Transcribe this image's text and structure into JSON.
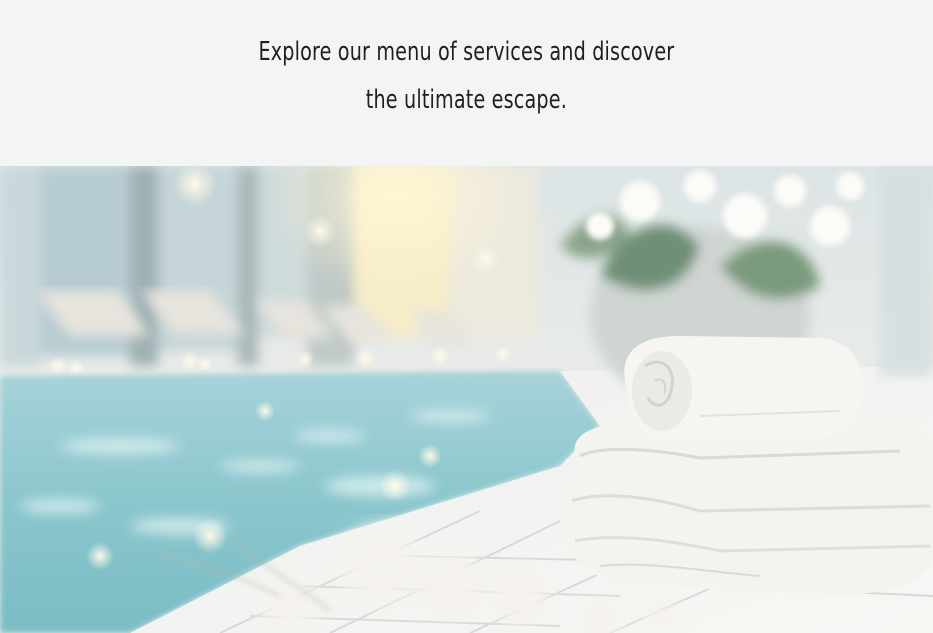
{
  "intro": {
    "line1": "Explore our menu of services and discover",
    "line2": "the ultimate escape."
  },
  "hero": {
    "subject": "spa-pool-towels-photo",
    "colors": {
      "pool": "#8ac6cd",
      "towel": "#f4f3ef",
      "wall": "#dfe6e8",
      "light": "#fbf0cc",
      "leaf": "#6f8f77"
    }
  }
}
